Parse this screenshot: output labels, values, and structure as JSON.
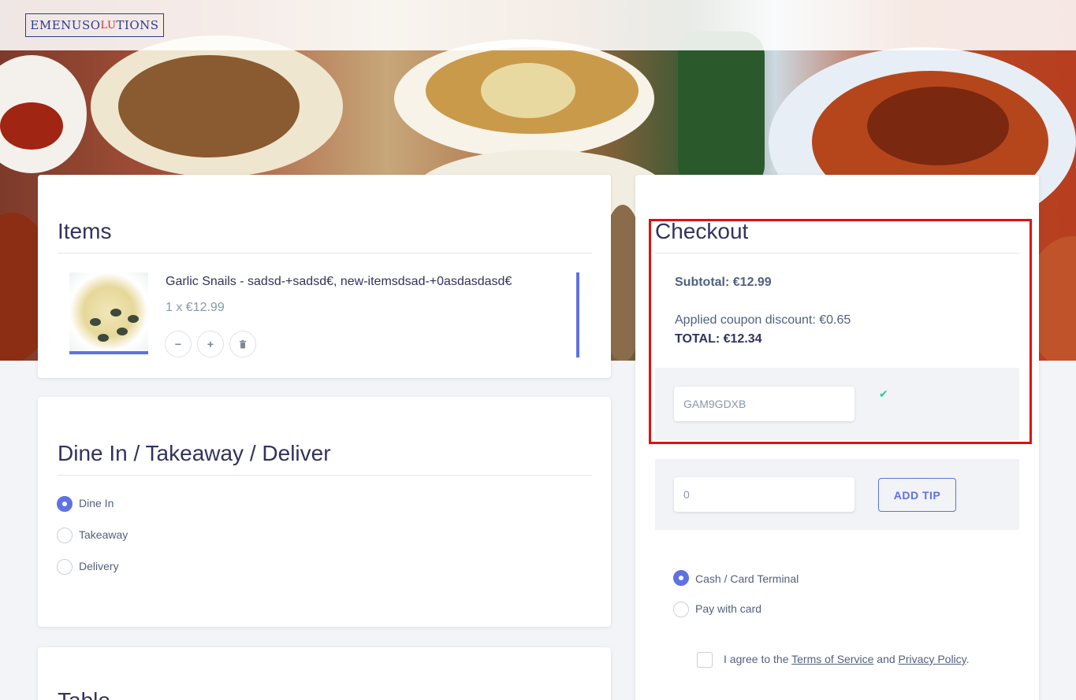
{
  "brand": {
    "logo_pre": "EMENUSO",
    "logo_mid": "LU",
    "logo_post": "TIONS"
  },
  "items_card": {
    "title": "Items",
    "item": {
      "name": "Garlic Snails - sadsd-+sadsd€, new-itemsdsad-+0asdasdasd€",
      "qty_price": "1 x €12.99",
      "minus": "−",
      "plus": "+",
      "trash": "🗑"
    }
  },
  "delivery_card": {
    "title": "Dine In / Takeaway / Deliver",
    "options": [
      "Dine In",
      "Takeaway",
      "Delivery"
    ],
    "selected": "Dine In"
  },
  "table_card": {
    "title": "Table"
  },
  "checkout": {
    "title": "Checkout",
    "subtotal": "Subtotal: €12.99",
    "discount": "Applied coupon discount: €0.65",
    "total": "TOTAL: €12.34",
    "coupon_value": "GAM9GDXB",
    "coupon_status": "✔",
    "tip_placeholder": "0",
    "add_tip": "ADD TIP",
    "payment_options": [
      "Cash / Card Terminal",
      "Pay with card"
    ],
    "payment_selected": "Cash / Card Terminal",
    "agree_pre": "I agree to the ",
    "terms": "Terms of Service",
    "agree_mid": " and ",
    "privacy": "Privacy Policy",
    "agree_post": "."
  },
  "colors": {
    "accent": "#5e72e4",
    "highlight": "#e01010",
    "success": "#2dce89"
  }
}
